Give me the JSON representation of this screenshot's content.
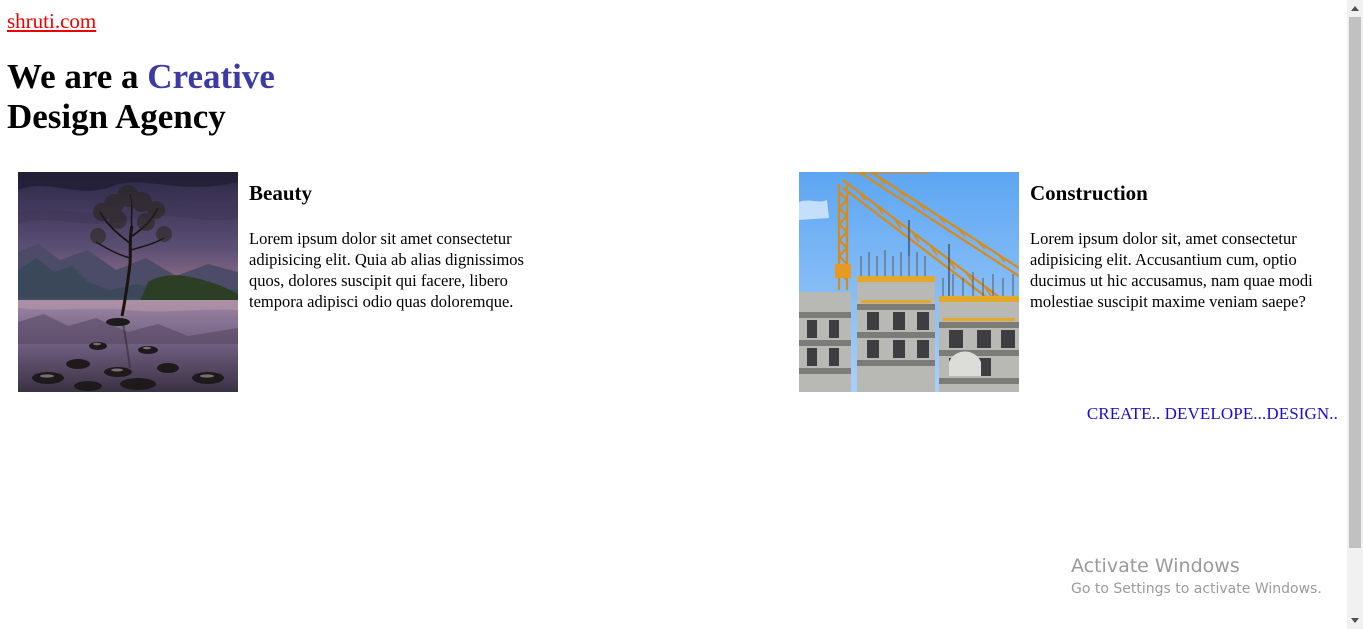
{
  "site": {
    "link_text": "shruti.com"
  },
  "hero": {
    "prefix": "We are a ",
    "accent": "Creative",
    "line2": "Design Agency"
  },
  "cards": [
    {
      "title": "Beauty",
      "text": "Lorem ipsum dolor sit amet consectetur\nadipisicing elit. Quia ab alias dignissimos\nquos, dolores suscipit qui facere, libero\ntempora adipisci odio quas doloremque.",
      "image": "lake-tree-photo"
    },
    {
      "title": "Construction",
      "text": "Lorem ipsum dolor sit, amet consectetur\nadipisicing elit. Accusantium cum, optio\nducimus ut hic accusamus, nam quae modi\nmolestiae suscipit maxime veniam saepe?",
      "image": "construction-crane-photo"
    }
  ],
  "tagline": "CREATE.. DEVELOPE...DESIGN..",
  "windows_notice": {
    "title": "Activate Windows",
    "subtitle": "Go to Settings to activate Windows."
  },
  "colors": {
    "link": "#ee0000",
    "accent": "#3b3ba3",
    "tagline": "#1a0dcc",
    "watermark": "#9a9a9a",
    "scrollbar_track": "#f1f1f1",
    "scrollbar_thumb": "#c1c1c1"
  },
  "icons": {
    "scroll_up": "triangle-up-icon",
    "scroll_down": "triangle-down-icon"
  }
}
